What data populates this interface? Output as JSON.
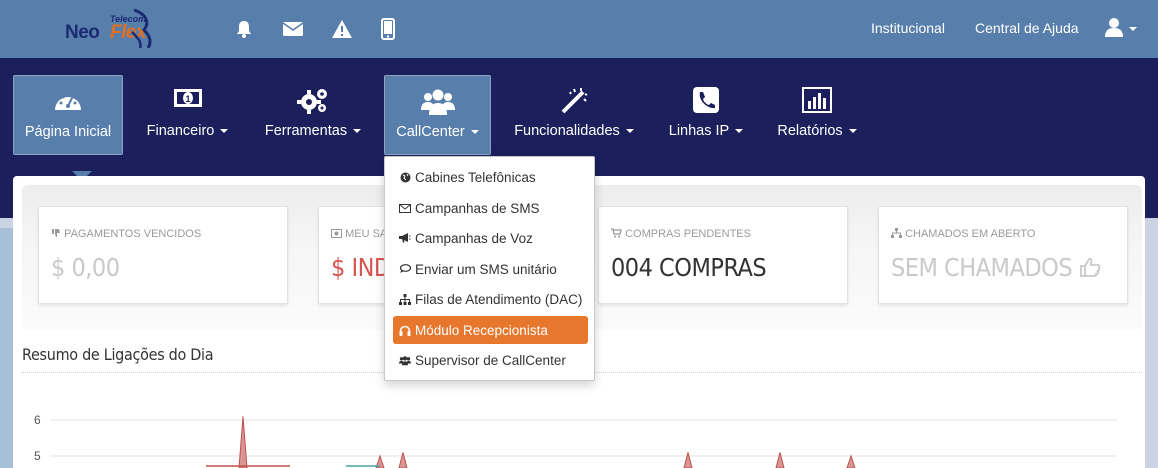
{
  "logo": {
    "part1": "Neo",
    "part2": "Flex",
    "tag": "Telecom"
  },
  "topbar": {
    "links": [
      "Institucional",
      "Central de Ajuda"
    ],
    "icons": [
      "bell-icon",
      "envelope-icon",
      "warning-icon",
      "mobile-icon",
      "user-icon"
    ]
  },
  "nav": {
    "items": [
      {
        "label": "Página Inicial",
        "icon": "dashboard-icon"
      },
      {
        "label": "Financeiro",
        "icon": "money-icon"
      },
      {
        "label": "Ferramentas",
        "icon": "gears-icon"
      },
      {
        "label": "CallCenter",
        "icon": "users-icon"
      },
      {
        "label": "Funcionalidades",
        "icon": "magic-wand-icon"
      },
      {
        "label": "Linhas IP",
        "icon": "phone-icon"
      },
      {
        "label": "Relatórios",
        "icon": "bar-chart-icon"
      }
    ]
  },
  "dropdown": {
    "items": [
      {
        "label": "Cabines Telefônicas",
        "icon": "globe-icon"
      },
      {
        "label": "Campanhas de SMS",
        "icon": "envelope-icon"
      },
      {
        "label": "Campanhas de Voz",
        "icon": "bullhorn-icon"
      },
      {
        "label": "Enviar um SMS unitário",
        "icon": "comment-icon"
      },
      {
        "label": "Filas de Atendimento (DAC)",
        "icon": "sitemap-icon"
      },
      {
        "label": "Módulo Recepcionista",
        "icon": "headphones-icon"
      },
      {
        "label": "Supervisor de CallCenter",
        "icon": "users-icon"
      }
    ],
    "active_index": 5
  },
  "cards": [
    {
      "title": "PAGAMENTOS VENCIDOS",
      "value": "$ 0,00",
      "icon": "thumbs-down-icon"
    },
    {
      "title": "MEU SA",
      "value": "$ INDI",
      "icon": "money-icon"
    },
    {
      "title": "COMPRAS PENDENTES",
      "value": "004 COMPRAS",
      "icon": "cart-icon"
    },
    {
      "title": "CHAMADOS EM ABERTO",
      "value": "SEM CHAMADOS",
      "icon": "sitemap-icon"
    }
  ],
  "section": {
    "title": "Resumo de Ligações do Dia"
  },
  "colors": {
    "topbar": "#587fab",
    "navbar": "#1b1f5c",
    "accent": "#e8772e",
    "negative": "#d9534f"
  },
  "chart_data": {
    "type": "area",
    "y_ticks": [
      6,
      5
    ],
    "ylim": [
      4.6,
      6.2
    ],
    "series": [
      {
        "color": "#c0504d",
        "peak_values": [
          6.1,
          5.0,
          5.1,
          5.1,
          5.1,
          5.0
        ]
      }
    ]
  }
}
